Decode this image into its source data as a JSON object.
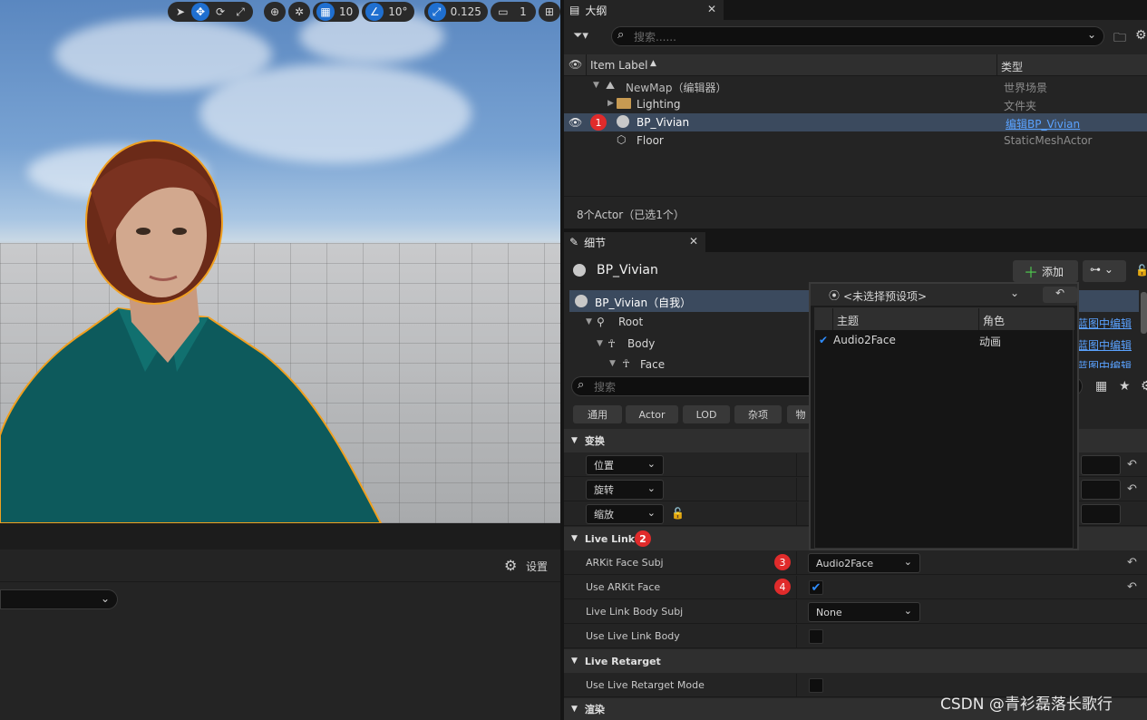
{
  "viewport": {
    "toolbar": {
      "grid_snap": "10",
      "angle_snap": "10°",
      "scale_snap": "0.125",
      "camera_speed": "1"
    }
  },
  "bottom_left": {
    "settings_label": "设置"
  },
  "outliner": {
    "tab_title": "大纲",
    "search_placeholder": "搜索......",
    "col_label": "Item Label",
    "col_type": "类型",
    "rows": [
      {
        "label": "NewMap（编辑器）",
        "type": "世界场景"
      },
      {
        "label": "Lighting",
        "type": "文件夹"
      },
      {
        "label": "BP_Vivian",
        "type": "编辑BP_Vivian"
      },
      {
        "label": "Floor",
        "type": "StaticMeshActor"
      }
    ],
    "status": "8个Actor（已选1个）",
    "badge_1": "1"
  },
  "details": {
    "tab_title": "细节",
    "actor_name": "BP_Vivian",
    "add_button": "添加",
    "components": [
      {
        "label": "BP_Vivian（自我）",
        "link": ""
      },
      {
        "label": "Root",
        "link": "蓝图中编辑"
      },
      {
        "label": "Body",
        "link": "蓝图中编辑"
      },
      {
        "label": "Face",
        "link": "蓝图中编辑"
      }
    ],
    "search_placeholder": "搜索",
    "filters": [
      "通用",
      "Actor",
      "LOD",
      "杂项",
      "物"
    ],
    "sections": {
      "transform": "变换",
      "live_link": "Live Link",
      "live_retarget": "Live Retarget",
      "rendering": "渲染"
    },
    "transform_rows": [
      "位置",
      "旋转",
      "缩放"
    ],
    "props": {
      "arkit_face_subj": {
        "name": "ARKit Face Subj",
        "value": "Audio2Face"
      },
      "use_arkit_face": {
        "name": "Use ARKit Face",
        "value": "✔"
      },
      "live_link_body_subj": {
        "name": "Live Link Body Subj",
        "value": "None"
      },
      "use_live_link_body": {
        "name": "Use Live Link Body"
      },
      "use_live_retarget_mode": {
        "name": "Use Live Retarget Mode"
      }
    },
    "badges": {
      "b2": "2",
      "b3": "3",
      "b4": "4"
    }
  },
  "popup": {
    "preset": "<未选择预设项>",
    "col_subject": "主题",
    "col_role": "角色",
    "rows": [
      {
        "subject": "Audio2Face",
        "role": "动画"
      }
    ]
  },
  "watermark": "CSDN @青衫磊落长歌行"
}
